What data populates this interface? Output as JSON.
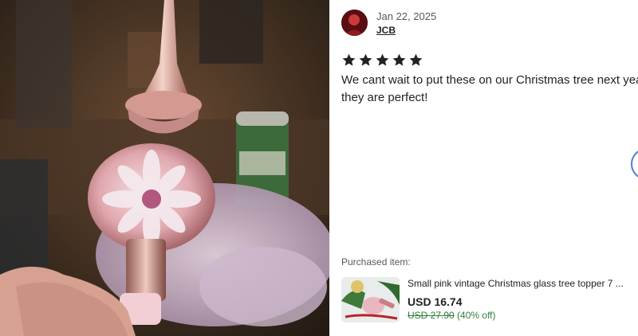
{
  "review": {
    "date": "Jan 22, 2025",
    "username": "JCB",
    "rating": 5,
    "rating_max": 5,
    "text": "We cant wait to put these on our Christmas tree next year, they are perfect!"
  },
  "purchase": {
    "label": "Purchased item:",
    "title": "Small pink vintage Christmas glass tree topper 7 ...",
    "price": "USD 16.74",
    "original_price": "USD 27.90",
    "discount": "(40% off)"
  },
  "colors": {
    "star": "#222222",
    "discount_green": "#2f7d3a",
    "nav_ring": "#4d7bd8",
    "avatar_bg": "#5a0d12"
  },
  "icons": {
    "rating": "star-icon",
    "navigation": "next-circle-icon"
  }
}
